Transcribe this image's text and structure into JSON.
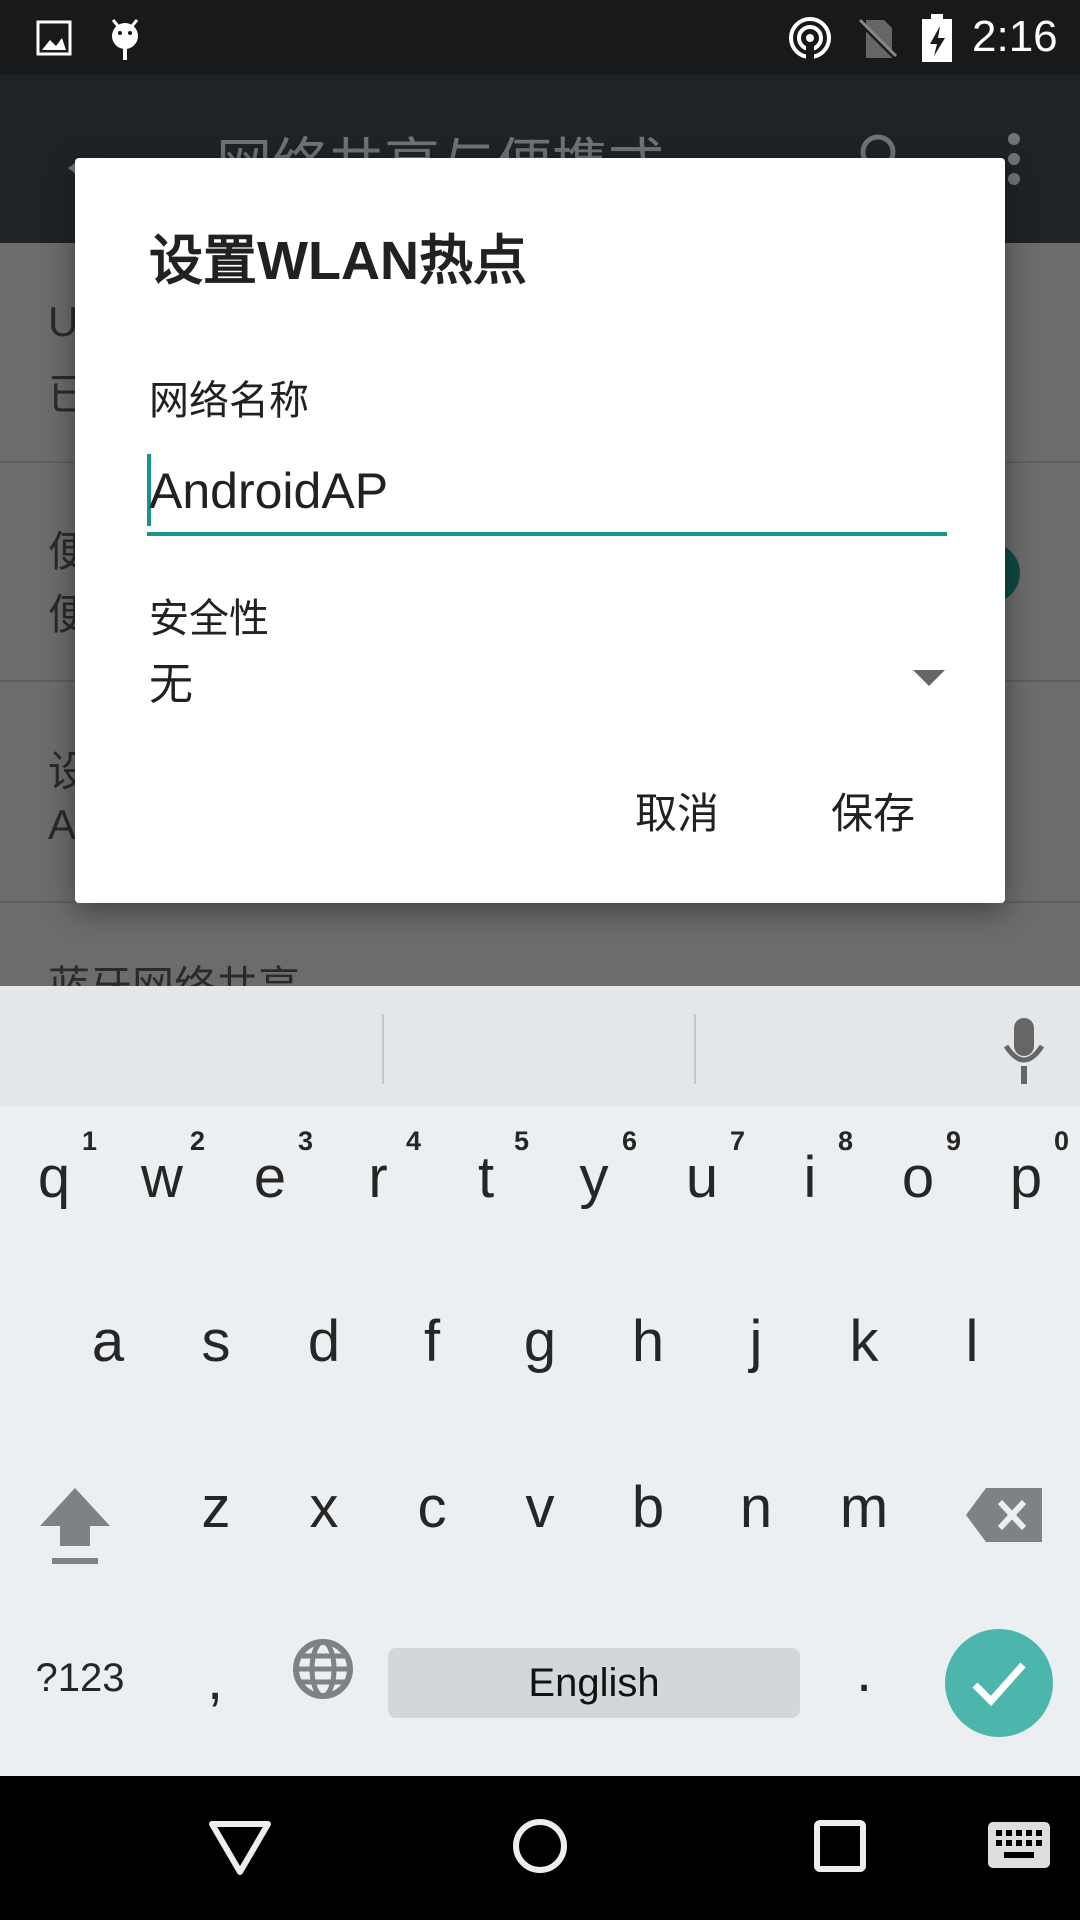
{
  "status_bar": {
    "time": "2:16",
    "icons": [
      "image-icon",
      "android-debug-icon",
      "hotspot-icon",
      "no-sim-icon",
      "battery-charging-icon"
    ]
  },
  "toolbar": {
    "title": "网络共享与便携式",
    "icons": [
      "back-arrow-icon",
      "search-icon",
      "more-vert-icon"
    ]
  },
  "background_list": {
    "items": [
      {
        "title": "U",
        "subtitle": "已"
      },
      {
        "title": "便",
        "subtitle": "便"
      },
      {
        "title": "设",
        "subtitle": "A"
      },
      {
        "title": "蓝牙网络共享"
      }
    ]
  },
  "dialog": {
    "title": "设置WLAN热点",
    "network_name_label": "网络名称",
    "network_name_value": "AndroidAP",
    "security_label": "安全性",
    "security_value": "无",
    "cancel": "取消",
    "save": "保存",
    "accent_color": "#159688"
  },
  "keyboard": {
    "row1": [
      {
        "k": "q",
        "h": "1"
      },
      {
        "k": "w",
        "h": "2"
      },
      {
        "k": "e",
        "h": "3"
      },
      {
        "k": "r",
        "h": "4"
      },
      {
        "k": "t",
        "h": "5"
      },
      {
        "k": "y",
        "h": "6"
      },
      {
        "k": "u",
        "h": "7"
      },
      {
        "k": "i",
        "h": "8"
      },
      {
        "k": "o",
        "h": "9"
      },
      {
        "k": "p",
        "h": "0"
      }
    ],
    "row2": [
      "a",
      "s",
      "d",
      "f",
      "g",
      "h",
      "j",
      "k",
      "l"
    ],
    "row3": [
      "z",
      "x",
      "c",
      "v",
      "b",
      "n",
      "m"
    ],
    "symbols": "?123",
    "comma": ",",
    "space": "English",
    "period": ".",
    "enter_color": "#4db6ac"
  },
  "nav_bar": {
    "icons": [
      "back-icon",
      "home-icon",
      "recents-icon",
      "keyboard-switch-icon"
    ]
  }
}
